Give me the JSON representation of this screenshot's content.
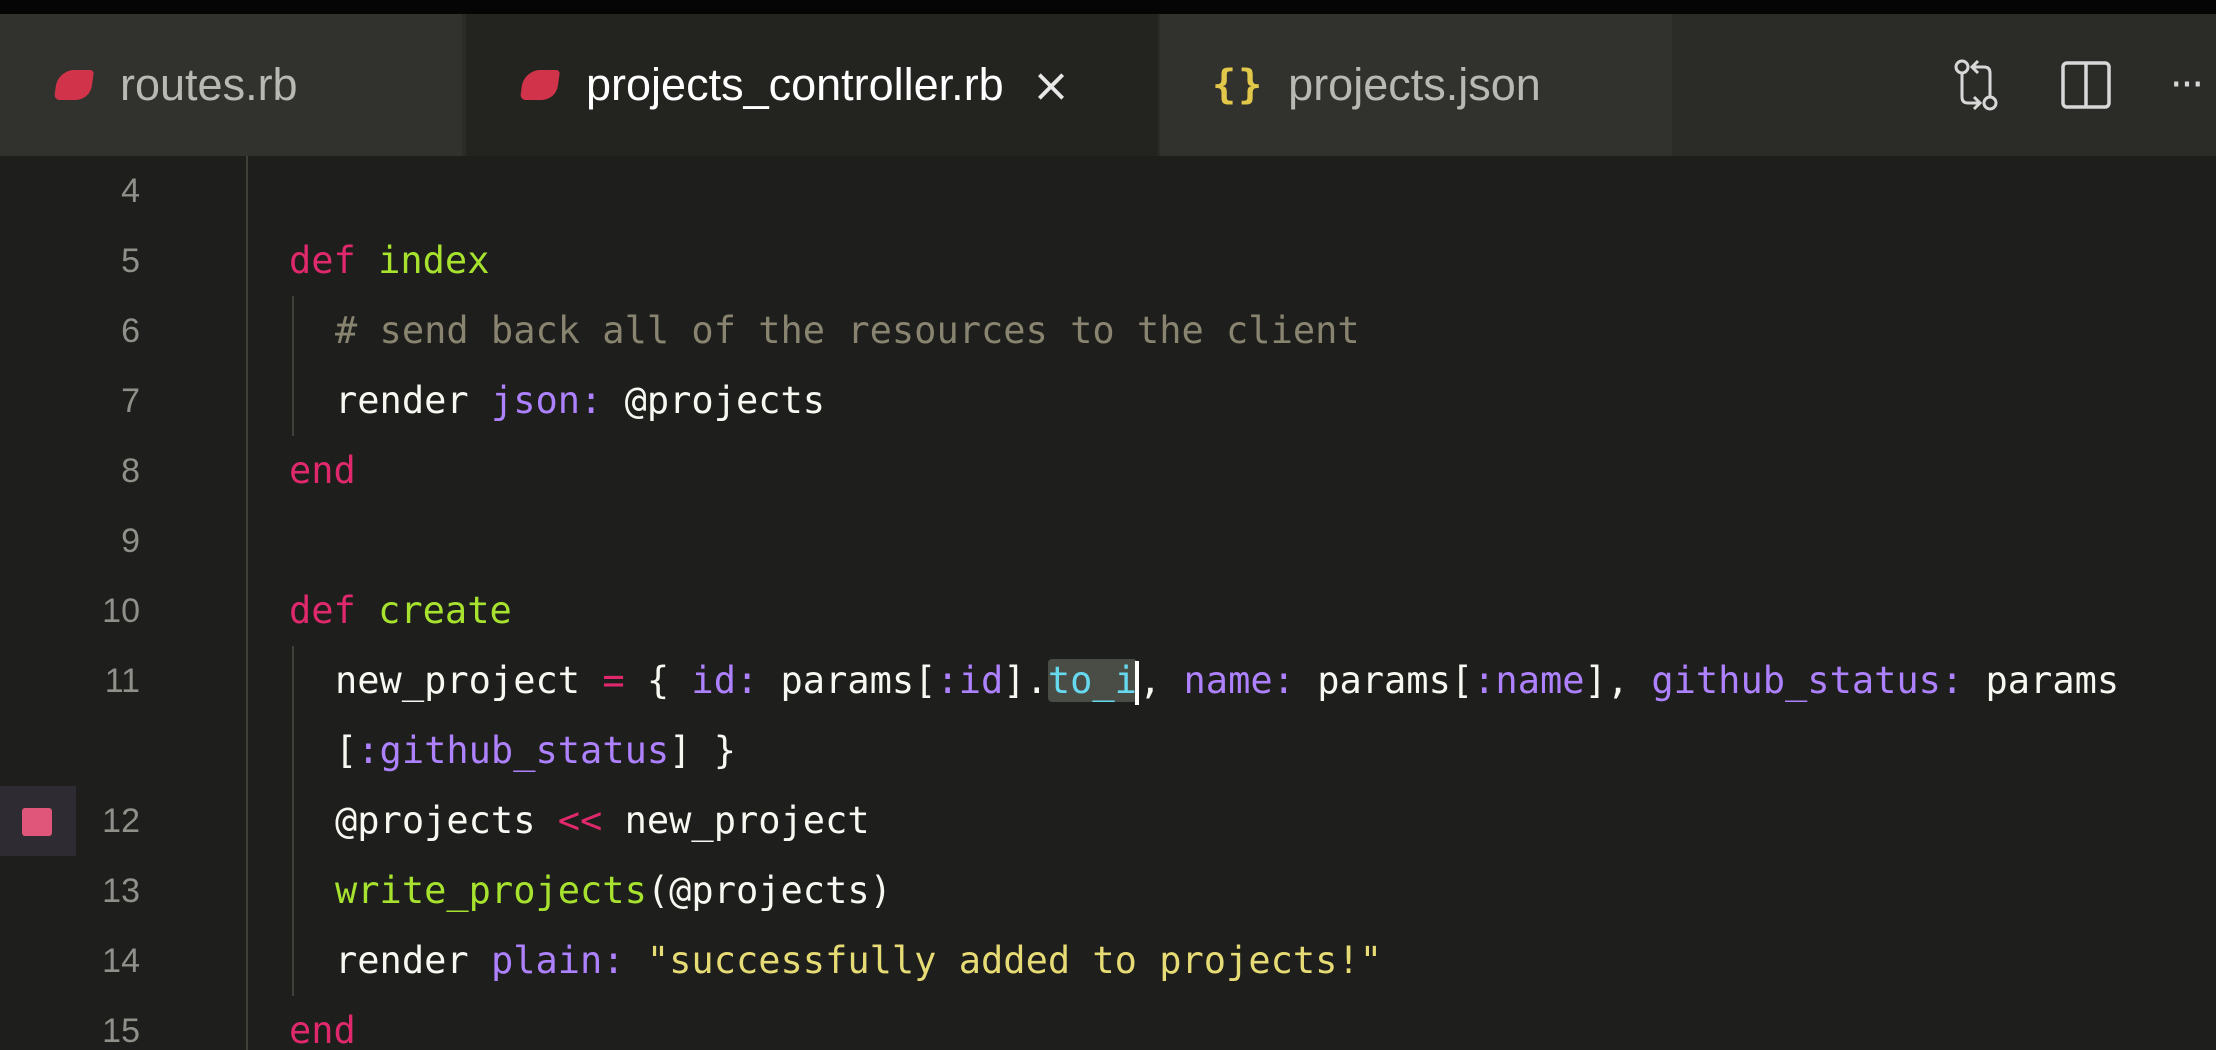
{
  "tabs": [
    {
      "label": "routes.rb",
      "icon": "ruby-icon",
      "active": false
    },
    {
      "label": "projects_controller.rb",
      "icon": "ruby-icon",
      "active": true,
      "close": "×"
    },
    {
      "label": "projects.json",
      "icon": "json-icon",
      "icon_text": "{}",
      "active": false
    }
  ],
  "actions": {
    "compare": "compare-changes-icon",
    "split": "split-editor-icon",
    "more": "···"
  },
  "editor": {
    "line_numbers": [
      "4",
      "5",
      "6",
      "7",
      "8",
      "9",
      "10",
      "11",
      "12",
      "13",
      "14",
      "15"
    ],
    "lines": {
      "l5": {
        "kw": "def",
        "name": "index"
      },
      "l6": {
        "comment": "# send back all of the resources to the client"
      },
      "l7": {
        "a": "render ",
        "b": "json:",
        "c": " @projects"
      },
      "l8": {
        "kw": "end"
      },
      "l10": {
        "kw": "def",
        "name": "create"
      },
      "l11": {
        "p1": "new_project ",
        "p2": "=",
        "p3": " { ",
        "p4": "id:",
        "p5": " params[",
        "p6": ":id",
        "p7": "].",
        "p8": "to_i",
        "p9": ", ",
        "p10": "name:",
        "p11": " params[",
        "p12": ":name",
        "p13": "], ",
        "p14": "github_status:",
        "p15": " params"
      },
      "l11b": {
        "a": "[",
        "b": ":github_status",
        "c": "] }"
      },
      "l12": {
        "a": "@projects ",
        "b": "<<",
        "c": " new_project"
      },
      "l13": {
        "a": "write_projects",
        "b": "(@projects)"
      },
      "l14": {
        "a": "render ",
        "b": "plain:",
        "c": " ",
        "d": "\"successfully added to projects!\""
      },
      "l15": {
        "kw": "end"
      }
    }
  },
  "colors": {
    "keyword": "#e0286c",
    "function": "#a6e22e",
    "comment": "#88846f",
    "symbol": "#ae81ff",
    "string": "#e6db74",
    "breakpoint": "#e0567a"
  }
}
